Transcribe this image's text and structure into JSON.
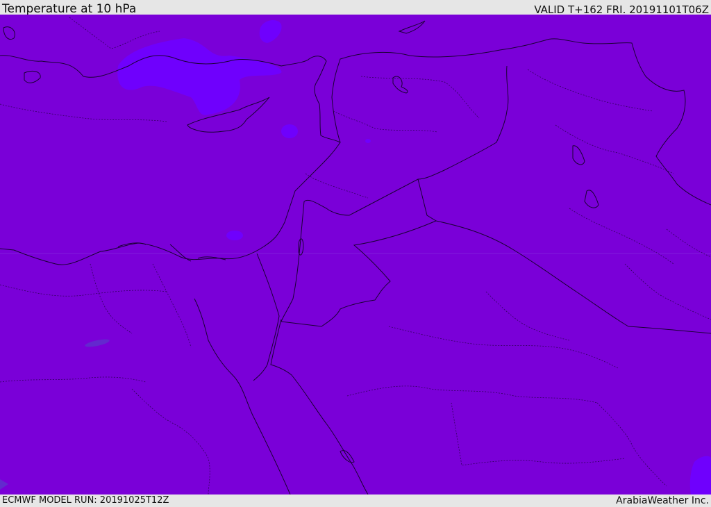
{
  "header": {
    "title": "Temperature at 10 hPa",
    "valid": "VALID T+162 FRI. 20191101T06Z"
  },
  "footer": {
    "model_run": "ECMWF MODEL RUN: 20191025T12Z",
    "credit": "ArabiaWeather Inc."
  },
  "colors": {
    "field_main": "#7a00d8",
    "field_warm": "#6f00ff",
    "field_cool": "#5e33cc",
    "border_line": "#1a0033",
    "bar_bg": "#e6e6e6"
  }
}
